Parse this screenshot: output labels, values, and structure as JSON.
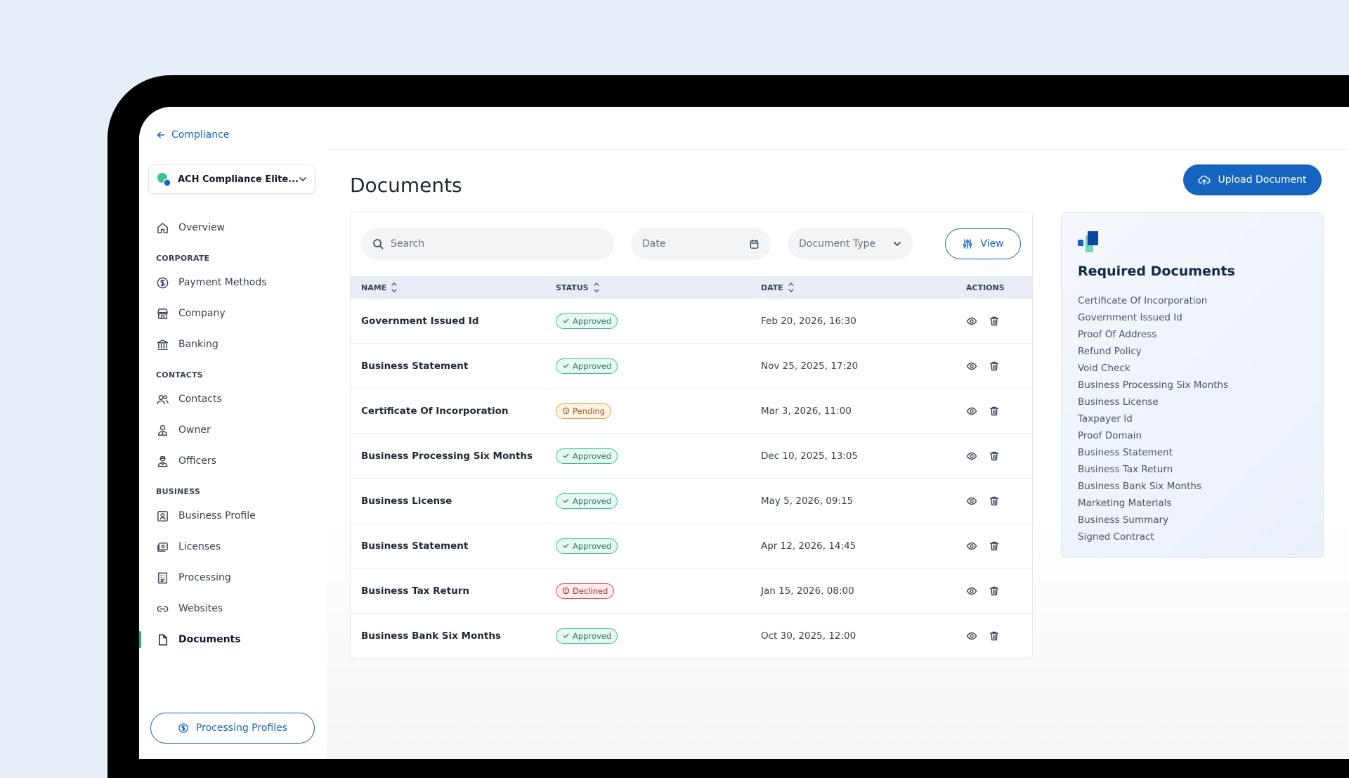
{
  "sidebar": {
    "back_label": "Compliance",
    "selector_label": "ACH Compliance Elite...",
    "overview": "Overview",
    "sections": {
      "corporate": "CORPORATE",
      "contacts": "CONTACTS",
      "business": "BUSINESS"
    },
    "items": {
      "payment_methods": "Payment Methods",
      "company": "Company",
      "banking": "Banking",
      "contacts": "Contacts",
      "owner": "Owner",
      "officers": "Officers",
      "business_profile": "Business Profile",
      "licenses": "Licenses",
      "processing": "Processing",
      "websites": "Websites",
      "documents": "Documents"
    },
    "processing_profiles_button": "Processing Profiles"
  },
  "main": {
    "title": "Documents",
    "upload_button": "Upload Document",
    "filters": {
      "search_placeholder": "Search",
      "date_placeholder": "Date",
      "doc_type_placeholder": "Document Type",
      "view_button": "View"
    },
    "table": {
      "headers": [
        "NAME",
        "STATUS",
        "DATE",
        "ACTIONS"
      ],
      "rows": [
        {
          "name": "Government Issued Id",
          "status": "Approved",
          "date": "Feb 20, 2026, 16:30"
        },
        {
          "name": "Business Statement",
          "status": "Approved",
          "date": "Nov 25, 2025, 17:20"
        },
        {
          "name": "Certificate Of Incorporation",
          "status": "Pending",
          "date": "Mar 3, 2026, 11:00"
        },
        {
          "name": "Business Processing Six Months",
          "status": "Approved",
          "date": "Dec 10, 2025, 13:05"
        },
        {
          "name": "Business License",
          "status": "Approved",
          "date": "May 5, 2026, 09:15"
        },
        {
          "name": "Business Statement",
          "status": "Approved",
          "date": "Apr 12, 2026, 14:45"
        },
        {
          "name": "Business Tax Return",
          "status": "Declined",
          "date": "Jan 15, 2026, 08:00"
        },
        {
          "name": "Business Bank Six Months",
          "status": "Approved",
          "date": "Oct 30, 2025, 12:00"
        }
      ]
    }
  },
  "required": {
    "title": "Required Documents",
    "items": [
      "Certificate Of Incorporation",
      "Government Issued Id",
      "Proof Of Address",
      "Refund Policy",
      "Void Check",
      "Business Processing Six Months",
      "Business License",
      "Taxpayer Id",
      "Proof Domain",
      "Business Statement",
      "Business Tax Return",
      "Business Bank Six Months",
      "Marketing Materials",
      "Business Summary",
      "Signed Contract"
    ]
  },
  "colors": {
    "accent": "#1565c0",
    "approved": "#34c496",
    "pending": "#f0a044",
    "declined": "#e84545",
    "active_indicator": "#10b981"
  }
}
